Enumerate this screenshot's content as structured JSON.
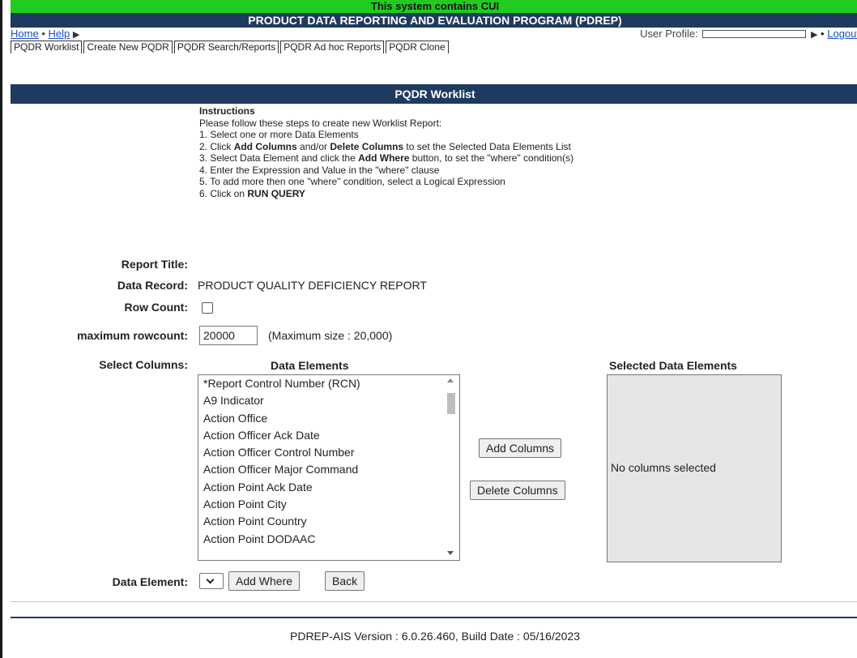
{
  "banner": {
    "cui": "This system contains CUI",
    "title": "PRODUCT DATA REPORTING AND EVALUATION PROGRAM (PDREP)"
  },
  "nav": {
    "home": "Home",
    "separator": "•",
    "help": "Help",
    "profile_label": "User Profile:",
    "logout": "Logout"
  },
  "tabs": [
    "PQDR Worklist",
    "Create New PQDR",
    "PQDR Search/Reports",
    "PQDR Ad hoc Reports",
    "PQDR Clone"
  ],
  "section_header": "PQDR Worklist",
  "instructions": {
    "heading": "Instructions",
    "intro": "Please follow these steps to create new Worklist Report:",
    "step1": "1. Select one or more Data Elements",
    "step2_a": "2. Click ",
    "step2_b": "Add Columns",
    "step2_c": " and/or ",
    "step2_d": "Delete Columns",
    "step2_e": " to set the Selected Data Elements List",
    "step3_a": "3. Select Data Element and click the ",
    "step3_b": "Add Where",
    "step3_c": " button, to set the \"where\" condition(s)",
    "step4": "4. Enter the Expression and Value in the \"where\" clause",
    "step5": "5. To add more then one \"where\" condition, select a Logical Expression",
    "step6_a": "6. Click on ",
    "step6_b": "RUN QUERY"
  },
  "form": {
    "report_title_label": "Report Title:",
    "data_record_label": "Data Record:",
    "data_record_value": "PRODUCT QUALITY DEFICIENCY REPORT",
    "row_count_label": "Row Count:",
    "max_rowcount_label": "maximum rowcount:",
    "max_rowcount_value": "20000",
    "max_size_note": "(Maximum size : 20,000)",
    "select_columns_label": "Select Columns:",
    "data_element_label": "Data Element:"
  },
  "columns": {
    "data_elements_heading": "Data Elements",
    "selected_heading": "Selected Data Elements",
    "options": [
      "*Report Control Number (RCN)",
      "A9 Indicator",
      "Action Office",
      "Action Officer Ack Date",
      "Action Officer Control Number",
      "Action Officer Major Command",
      "Action Point Ack Date",
      "Action Point City",
      "Action Point Country",
      "Action Point DODAAC"
    ],
    "no_columns": "No columns selected",
    "scroll_fraction": 0.03
  },
  "buttons": {
    "add_columns": "Add Columns",
    "delete_columns": "Delete Columns",
    "add_where": "Add Where",
    "back": "Back"
  },
  "footer": "PDREP-AIS  Version : 6.0.26.460, Build Date : 05/16/2023"
}
